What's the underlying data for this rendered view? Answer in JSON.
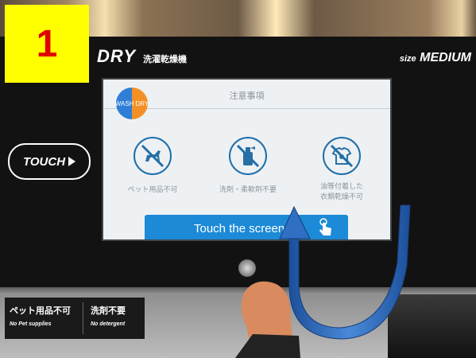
{
  "step": {
    "number": "1",
    "badge_color": "#ffff00",
    "number_color": "#e00000"
  },
  "brand": {
    "title": "DRY",
    "subtitle_jp": "洗濯乾燥機",
    "size_prefix": "size",
    "size_value": "MEDIUM"
  },
  "touch_label": "TOUCH",
  "screen": {
    "title": "注意事項",
    "logo_left": "WASH",
    "logo_right": "DRY",
    "icons": [
      {
        "name": "no-pet-icon",
        "label": "ペット用品不可"
      },
      {
        "name": "no-detergent-icon",
        "label": "洗剤・柔軟剤不要"
      },
      {
        "name": "no-oily-clothes-icon",
        "label_line1": "油等付着した",
        "label_line2": "衣類乾燥不可"
      }
    ],
    "button_label": "Touch the screen",
    "button_color": "#1c8ad7"
  },
  "bottom_sign": {
    "left_jp": "ペット用品不可",
    "left_en": "No Pet supplies",
    "right_jp": "洗剤不要",
    "right_en": "No detergent"
  },
  "arrow_color": "#2f6fc4"
}
